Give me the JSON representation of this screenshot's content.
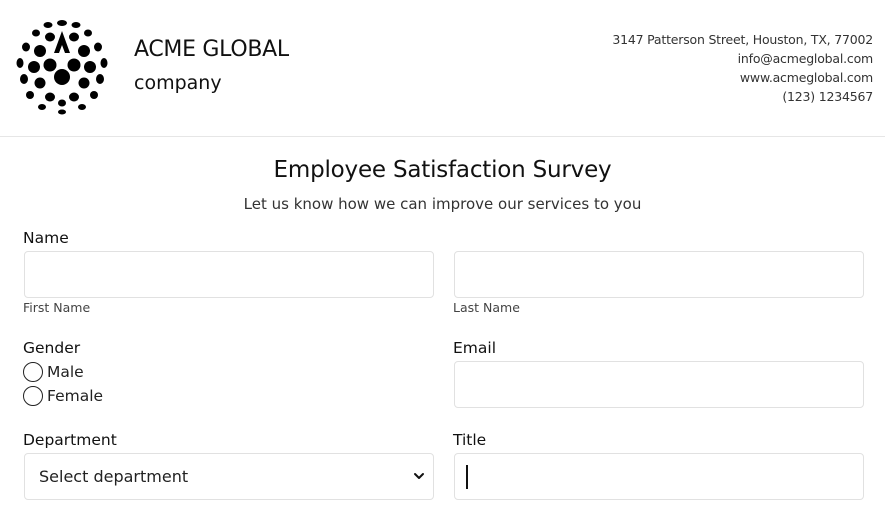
{
  "brand": {
    "name": "ACME GLOBAL",
    "sub": "company"
  },
  "contact": {
    "address": "3147 Patterson Street, Houston, TX, 77002",
    "email": "info@acmeglobal.com",
    "website": "www.acmeglobal.com",
    "phone": "(123) 1234567"
  },
  "form": {
    "title": "Employee Satisfaction Survey",
    "subtitle": "Let us know how we can improve our services to you",
    "name_label": "Name",
    "first_name_sublabel": "First Name",
    "last_name_sublabel": "Last Name",
    "first_name_value": "",
    "last_name_value": "",
    "gender_label": "Gender",
    "gender_options": [
      "Male",
      "Female"
    ],
    "email_label": "Email",
    "email_value": "",
    "department_label": "Department",
    "department_selected": "Select department",
    "title_label": "Title",
    "title_value": ""
  }
}
